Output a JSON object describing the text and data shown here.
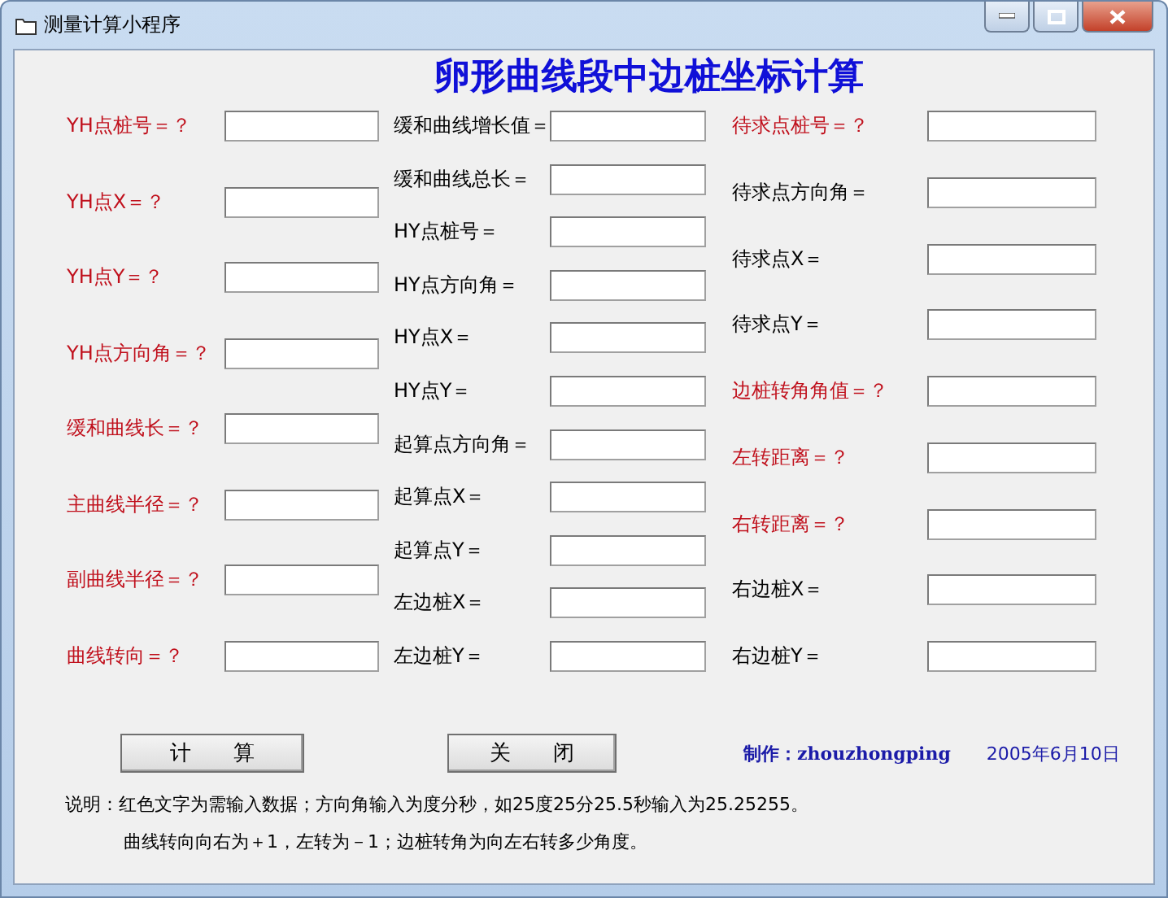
{
  "window": {
    "title": "测量计算小程序"
  },
  "heading": "卵形曲线段中边桩坐标计算",
  "columns": [
    [
      {
        "label": "YH点桩号＝？",
        "required": true
      },
      {
        "label": "YH点X＝？",
        "required": true
      },
      {
        "label": "YH点Y＝？",
        "required": true
      },
      {
        "label": "YH点方向角＝？",
        "required": true
      },
      {
        "label": "缓和曲线长＝？",
        "required": true
      },
      {
        "label": "主曲线半径＝？",
        "required": true
      },
      {
        "label": "副曲线半径＝？",
        "required": true
      },
      {
        "label": "曲线转向＝？",
        "required": true
      }
    ],
    [
      {
        "label": "缓和曲线增长值＝",
        "required": false
      },
      {
        "label": "缓和曲线总长＝",
        "required": false
      },
      {
        "label": "HY点桩号＝",
        "required": false
      },
      {
        "label": "HY点方向角＝",
        "required": false
      },
      {
        "label": "HY点X＝",
        "required": false
      },
      {
        "label": "HY点Y＝",
        "required": false
      },
      {
        "label": "起算点方向角＝",
        "required": false
      },
      {
        "label": "起算点X＝",
        "required": false
      },
      {
        "label": "起算点Y＝",
        "required": false
      },
      {
        "label": "左边桩X＝",
        "required": false
      },
      {
        "label": "左边桩Y＝",
        "required": false
      }
    ],
    [
      {
        "label": "待求点桩号＝？",
        "required": true
      },
      {
        "label": "待求点方向角＝",
        "required": false
      },
      {
        "label": "待求点X＝",
        "required": false
      },
      {
        "label": "待求点Y＝",
        "required": false
      },
      {
        "label": "边桩转角角值＝？",
        "required": true
      },
      {
        "label": "左转距离＝？",
        "required": true
      },
      {
        "label": "右转距离＝？",
        "required": true
      },
      {
        "label": "右边桩X＝",
        "required": false
      },
      {
        "label": "右边桩Y＝",
        "required": false
      }
    ]
  ],
  "buttons": [
    "计　　算",
    "关　　闭"
  ],
  "credit": {
    "author": "制作：zhouzhongping",
    "date": "2005年6月10日"
  },
  "notes": [
    "说明：红色文字为需输入数据；方向角输入为度分秒，如25度25分25.5秒输入为25.25255。",
    "曲线转向向右为＋1，左转为－1；边桩转角为向左右转多少角度。"
  ]
}
